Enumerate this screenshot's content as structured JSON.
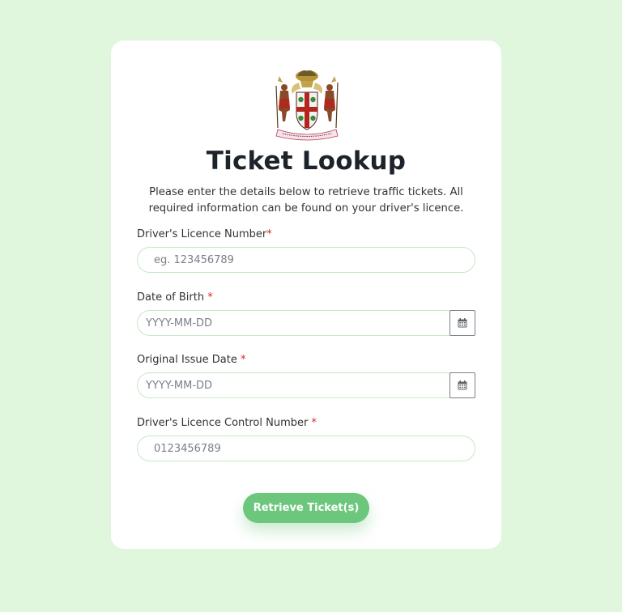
{
  "page": {
    "title": "Ticket Lookup",
    "subtitle": "Please enter the details below to retrieve traffic tickets. All required information can be found on your driver's licence.",
    "crest_motto": "OUT OF MANY, ONE PEOPLE",
    "required_marker": "*"
  },
  "form": {
    "licence_number": {
      "label": "Driver's Licence Number",
      "placeholder": "eg. 123456789",
      "value": ""
    },
    "date_of_birth": {
      "label": "Date of Birth ",
      "placeholder": "YYYY-MM-DD",
      "value": "",
      "calendar_icon": "calendar-icon"
    },
    "issue_date": {
      "label": "Original Issue Date ",
      "placeholder": "YYYY-MM-DD",
      "value": "",
      "calendar_icon": "calendar-icon"
    },
    "control_number": {
      "label": "Driver's Licence Control Number ",
      "placeholder": "0123456789",
      "value": ""
    },
    "submit_label": "Retrieve Ticket(s)"
  },
  "colors": {
    "background": "#e0f7dd",
    "card": "#ffffff",
    "accent": "#6cc77c",
    "required": "#d6252e",
    "input_border": "#c6e8c3"
  }
}
